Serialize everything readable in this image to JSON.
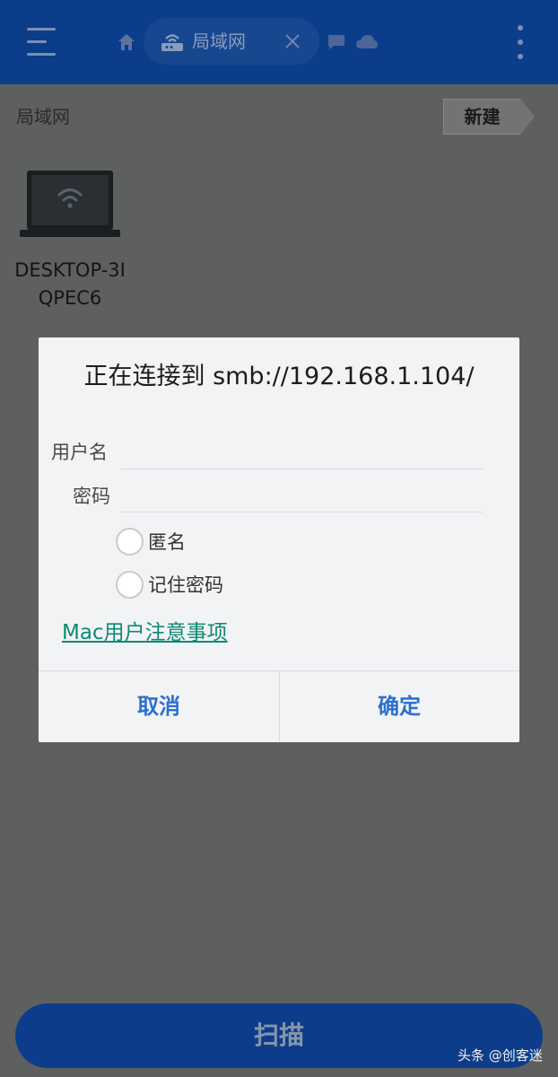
{
  "header": {
    "tab_label": "局域网",
    "icons": [
      "menu-icon",
      "home-icon",
      "router-icon",
      "close-icon",
      "chat-icon",
      "cloud-icon",
      "more-vertical-icon"
    ]
  },
  "breadcrumb": "局域网",
  "new_button": "新建",
  "device": {
    "name": "DESKTOP-3IQPEC6",
    "icon": "laptop-wifi-icon"
  },
  "dialog": {
    "title": "正在连接到 smb://192.168.1.104/",
    "username_label": "用户名",
    "username_value": "",
    "password_label": "密码",
    "password_value": "",
    "anonymous_label": "匿名",
    "anonymous_checked": false,
    "remember_label": "记住密码",
    "remember_checked": false,
    "mac_link": "Mac用户注意事项",
    "cancel": "取消",
    "ok": "确定"
  },
  "scan_button": "扫描",
  "watermark": "头条 @创客迷",
  "colors": {
    "topbar": "#0b3d8a",
    "overlay": "#5e5f5f",
    "dialog_bg": "#f2f3f5",
    "link": "#0d8a74",
    "button_text": "#2d6fd0"
  }
}
